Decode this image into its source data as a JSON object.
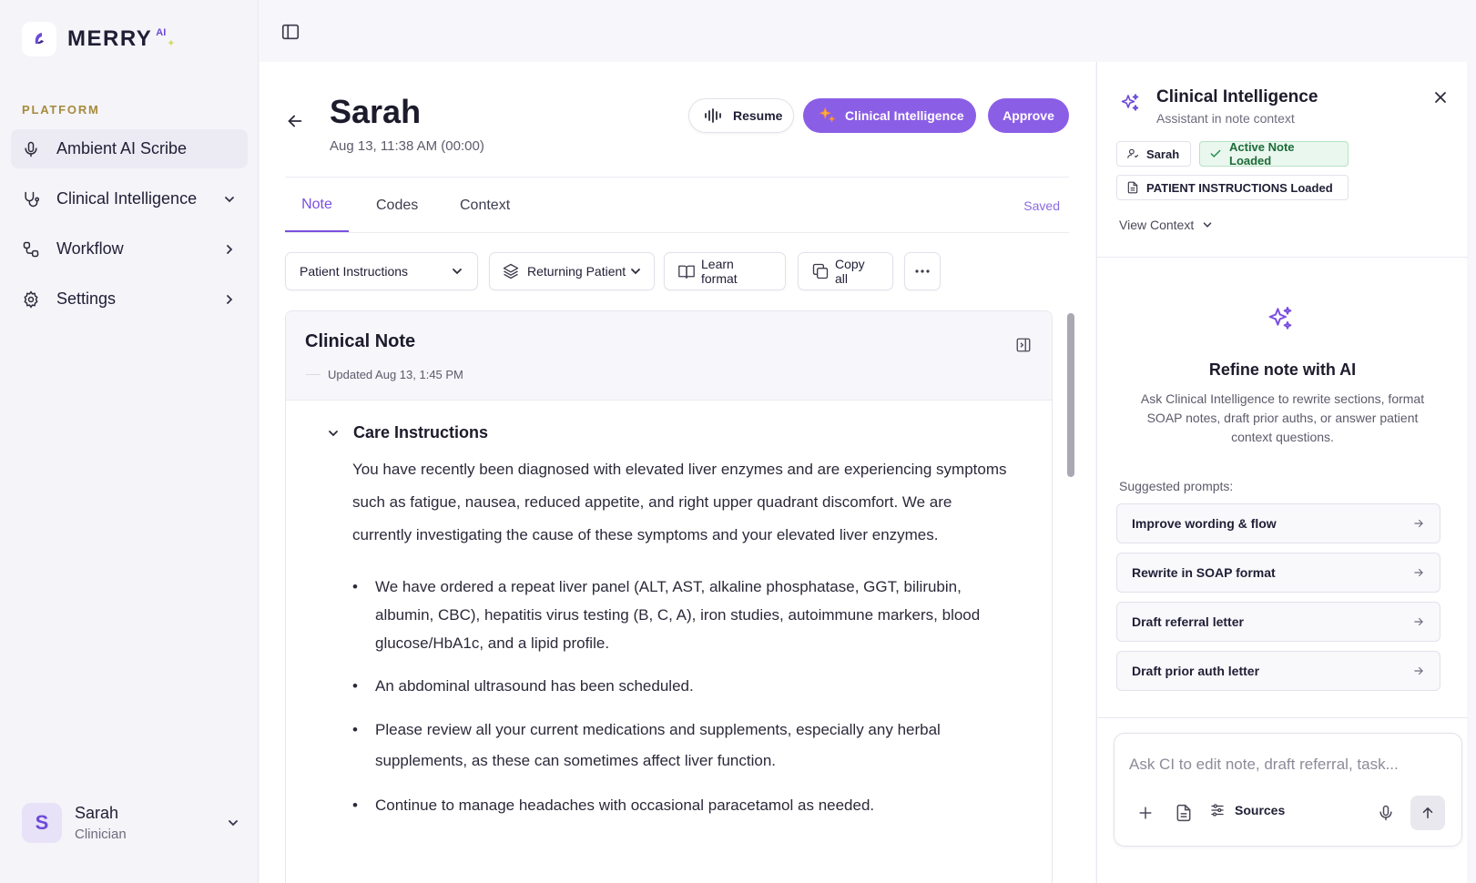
{
  "brand": {
    "name": "MERRY",
    "superscript": "AI"
  },
  "sidebar": {
    "section_label": "PLATFORM",
    "items": [
      {
        "label": "Ambient AI Scribe",
        "icon": "microphone-icon",
        "active": true
      },
      {
        "label": "Clinical Intelligence",
        "icon": "stethoscope-icon",
        "chevron": "down"
      },
      {
        "label": "Workflow",
        "icon": "workflow-icon",
        "chevron": "right"
      },
      {
        "label": "Settings",
        "icon": "gear-icon",
        "chevron": "right"
      }
    ],
    "user": {
      "initial": "S",
      "name": "Sarah",
      "role": "Clinician"
    }
  },
  "header": {
    "patient_name": "Sarah",
    "timestamp": "Aug 13, 11:38 AM (00:00)",
    "resume_label": "Resume",
    "ci_label": "Clinical Intelligence",
    "approve_label": "Approve"
  },
  "tabs": [
    {
      "label": "Note",
      "active": true
    },
    {
      "label": "Codes"
    },
    {
      "label": "Context"
    }
  ],
  "save_status": "Saved",
  "toolbar": {
    "template": "Patient Instructions",
    "visit_type": "Returning Patient",
    "learn_format": "Learn format",
    "copy_all": "Copy all"
  },
  "note": {
    "title": "Clinical Note",
    "updated": "Updated Aug 13, 1:45 PM",
    "section_title": "Care Instructions",
    "paragraph": "You have recently been diagnosed with elevated liver enzymes and are experiencing symptoms such as fatigue, nausea, reduced appetite, and right upper quadrant discomfort. We are currently investigating the cause of these symptoms and your elevated liver enzymes.",
    "bullets": [
      "We have ordered a repeat liver panel (ALT, AST, alkaline phosphatase, GGT, bilirubin, albumin, CBC), hepatitis virus testing (B, C, A), iron studies, autoimmune markers, blood glucose/HbA1c, and a lipid profile.",
      "An abdominal ultrasound has been scheduled.",
      "Please review all your current medications and supplements, especially any herbal supplements, as these can sometimes affect liver function.",
      "Continue to manage headaches with occasional paracetamol as needed."
    ]
  },
  "panel": {
    "title": "Clinical Intelligence",
    "subtitle": "Assistant in note context",
    "chip_patient": "Sarah",
    "chip_active": "Active Note Loaded",
    "chip_instructions": "PATIENT INSTRUCTIONS Loaded",
    "view_context": "View Context",
    "refine_title": "Refine note with AI",
    "refine_desc": "Ask Clinical Intelligence to rewrite sections, format SOAP notes, draft prior auths, or answer patient context questions.",
    "suggested_label": "Suggested prompts:",
    "prompts": [
      "Improve wording & flow",
      "Rewrite in SOAP format",
      "Draft referral letter",
      "Draft prior auth letter"
    ],
    "composer_placeholder": "Ask CI to edit note, draft referral, task...",
    "sources_label": "Sources"
  },
  "colors": {
    "accent": "#8b5ee6",
    "accent_text": "#7a4fe0",
    "success_bg": "#eaf7ee",
    "success_text": "#1d6b37"
  }
}
